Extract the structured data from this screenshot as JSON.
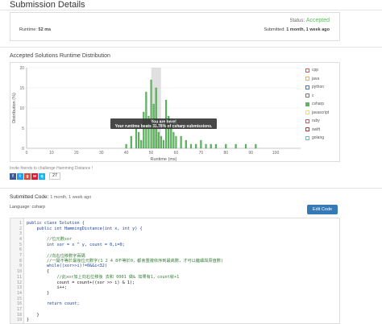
{
  "page": {
    "title": "Submission Details",
    "status_label": "Status:",
    "status_value": "Accepted",
    "runtime_label": "Runtime:",
    "runtime_value": "52 ms",
    "submitted_label": "Submitted:",
    "submitted_value": "1 month, 1 week ago"
  },
  "chart_section": {
    "title": "Accepted Solutions Runtime Distribution",
    "tooltip_line1": "You are here!",
    "tooltip_line2": "Your runtime beats 31.78% of csharp submissions."
  },
  "chart_data": {
    "type": "bar",
    "title": "",
    "xlabel": "Runtime (ms)",
    "ylabel": "Distribution (%)",
    "xlim": [
      0,
      110
    ],
    "ylim": [
      0,
      20
    ],
    "x_ticks": [
      0,
      10,
      20,
      30,
      40,
      50,
      60,
      70,
      80,
      90,
      100
    ],
    "y_ticks": [
      0,
      5,
      10,
      15,
      20
    ],
    "highlight_x": 52,
    "x": [
      40,
      42,
      44,
      45,
      46,
      47,
      48,
      49,
      50,
      51,
      52,
      53,
      54,
      55,
      56,
      57,
      58,
      59,
      60,
      62,
      64,
      66,
      68,
      70,
      72,
      74,
      76,
      80,
      84,
      88,
      92
    ],
    "values": [
      1,
      3,
      5,
      4,
      2,
      9,
      14,
      8,
      17,
      11,
      15,
      4,
      3,
      2,
      12,
      8,
      7,
      4,
      3,
      3,
      2,
      1,
      1,
      2,
      1,
      1,
      1,
      1,
      1,
      1,
      1
    ],
    "series_color": "#5cb85c",
    "highlight_color": "#999999",
    "legend": [
      {
        "name": "cpp",
        "color": "#d9534f",
        "checked": false
      },
      {
        "name": "java",
        "color": "#f0ad4e",
        "checked": false
      },
      {
        "name": "python",
        "color": "#337ab7",
        "checked": false
      },
      {
        "name": "c",
        "color": "#777777",
        "checked": false
      },
      {
        "name": "csharp",
        "color": "#5cb85c",
        "checked": true
      },
      {
        "name": "javascript",
        "color": "#f0e442",
        "checked": false
      },
      {
        "name": "ruby",
        "color": "#d9534f",
        "checked": false
      },
      {
        "name": "swift",
        "color": "#c9302c",
        "checked": false
      },
      {
        "name": "golang",
        "color": "#5bc0de",
        "checked": false
      }
    ],
    "grid": true,
    "legend_placement": "right"
  },
  "share": {
    "invite_text": "Invite friends to challenge Hamming Distance !",
    "buttons": [
      {
        "name": "facebook",
        "glyph": "f",
        "color": "#3b5998"
      },
      {
        "name": "twitter",
        "glyph": "t",
        "color": "#1da1f2"
      },
      {
        "name": "google-plus",
        "glyph": "g",
        "color": "#dd4b39"
      },
      {
        "name": "weibo",
        "glyph": "w",
        "color": "#e6162d"
      },
      {
        "name": "qq",
        "glyph": "q",
        "color": "#12b7f5"
      }
    ],
    "count": "27"
  },
  "code_section": {
    "heading": "Submitted Code:",
    "heading_meta": "1 month, 1 week ago",
    "language_label": "Language:",
    "language_value": "csharp",
    "edit_label": "Edit Code",
    "lines": [
      {
        "n": "1",
        "text": "public class Solution {"
      },
      {
        "n": "2",
        "text": "    public int HammingDistance(int x, int y) {"
      },
      {
        "n": "3",
        "text": ""
      },
      {
        "n": "4",
        "text": "        //位元數xor"
      },
      {
        "n": "5",
        "text": "        int xor = x ^ y, count = 0,i=0;"
      },
      {
        "n": "6",
        "text": ""
      },
      {
        "n": "7",
        "text": "        //向右位移數字兩碼"
      },
      {
        "n": "8",
        "text": "        //一開不等於最後位元數字(1 2 4 8不等於0，都會重複依序到最高數，才可以繼續與原值數)"
      },
      {
        "n": "9",
        "text": "        while((xor>>i)!=0&&i<32)"
      },
      {
        "n": "10",
        "text": "        {"
      },
      {
        "n": "11",
        "text": "            //此xor加上向右位移後 去和 0001 做& 如果有1，count就+1"
      },
      {
        "n": "12",
        "text": "            count = count+((xor >> i) & 1);"
      },
      {
        "n": "13",
        "text": "            i++;"
      },
      {
        "n": "14",
        "text": "        }"
      },
      {
        "n": "15",
        "text": ""
      },
      {
        "n": "16",
        "text": "        return count;"
      },
      {
        "n": "17",
        "text": ""
      },
      {
        "n": "18",
        "text": "    }"
      },
      {
        "n": "19",
        "text": "}"
      }
    ]
  }
}
